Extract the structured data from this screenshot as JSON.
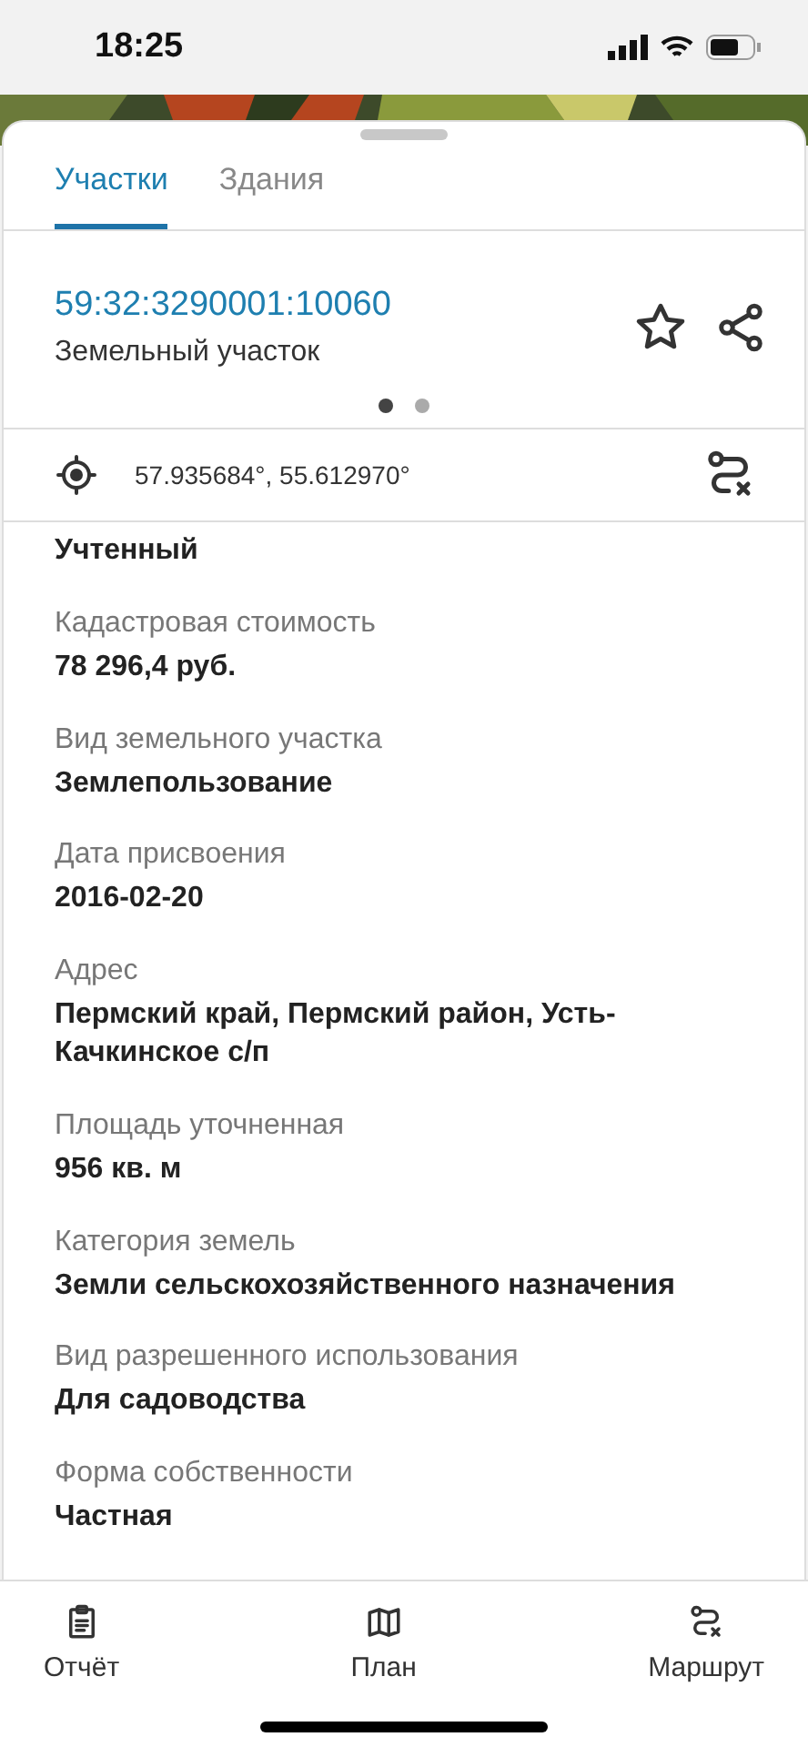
{
  "status_bar": {
    "time": "18:25"
  },
  "tabs": [
    {
      "label": "Участки",
      "selected": true
    },
    {
      "label": "Здания",
      "selected": false
    }
  ],
  "parcel": {
    "number": "59:32:3290001:10060",
    "type": "Земельный участок"
  },
  "pager": [
    {
      "selected": true
    },
    {
      "selected": false
    }
  ],
  "coordinates": "57.935684°, 55.612970°",
  "fields": [
    {
      "value": "Учтенный"
    },
    {
      "label": "Кадастровая стоимость",
      "value": "78 296,4 руб."
    },
    {
      "label": "Вид земельного участка",
      "value": "Землепользование"
    },
    {
      "label": "Дата присвоения",
      "value": "2016-02-20"
    },
    {
      "label": "Адрес",
      "value": "Пермский край, Пермский район, Усть-Качкинское с/п"
    },
    {
      "label": "Площадь уточненная",
      "value": "956 кв. м"
    },
    {
      "label": "Категория земель",
      "value": "Земли сельскохозяйственного назначения"
    },
    {
      "label": "Вид разрешенного использования",
      "value": "Для садоводства"
    },
    {
      "label": "Форма собственности",
      "value": "Частная"
    }
  ],
  "bottom_nav": [
    {
      "kind": "report",
      "label": "Отчёт"
    },
    {
      "kind": "plan",
      "label": "План"
    },
    {
      "kind": "route",
      "label": "Маршрут"
    }
  ]
}
